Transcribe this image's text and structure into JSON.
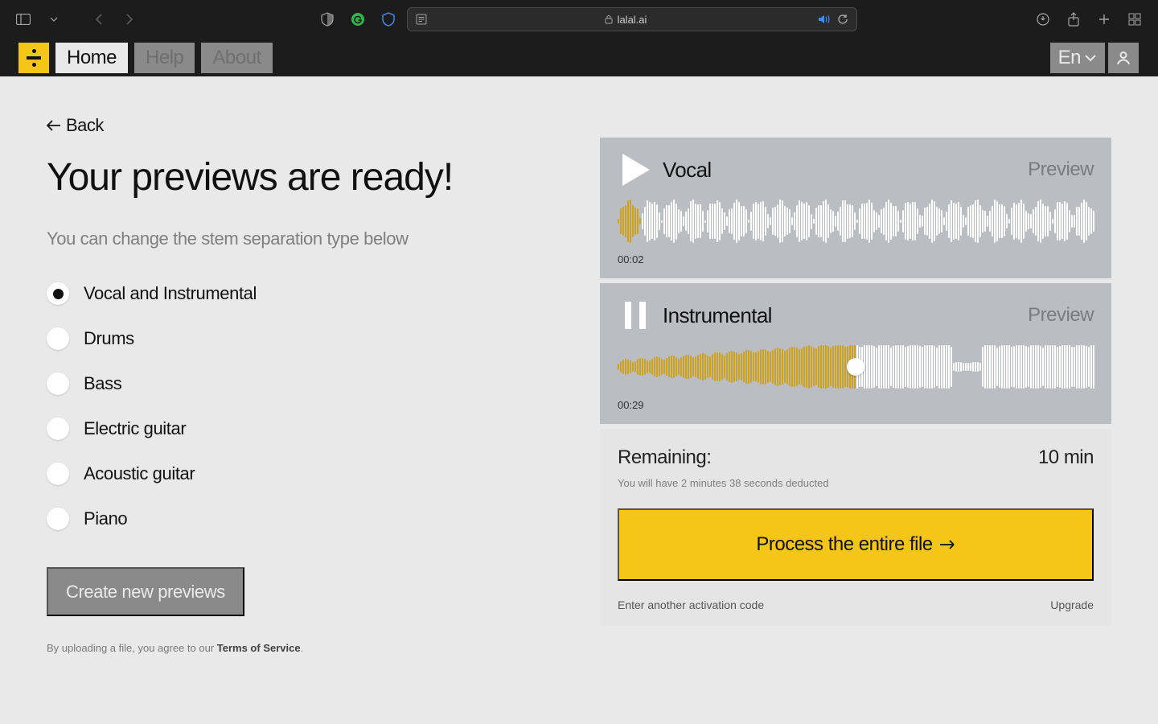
{
  "browser": {
    "url_domain": "lalal.ai"
  },
  "nav": {
    "home": "Home",
    "help": "Help",
    "about": "About",
    "lang": "En"
  },
  "back_label": "Back",
  "title": "Your previews are ready!",
  "subtitle": "You can change the stem separation type below",
  "stems": {
    "opt0": "Vocal and Instrumental",
    "opt1": "Drums",
    "opt2": "Bass",
    "opt3": "Electric guitar",
    "opt4": "Acoustic guitar",
    "opt5": "Piano"
  },
  "create_button": "Create new previews",
  "tos_prefix": "By uploading a file, you agree to our ",
  "tos_link": "Terms of Service",
  "tos_suffix": ".",
  "preview_label": "Preview",
  "tracks": {
    "vocal": {
      "name": "Vocal",
      "time": "00:02",
      "progress": 0.05
    },
    "instrumental": {
      "name": "Instrumental",
      "time": "00:29",
      "progress": 0.5
    }
  },
  "remaining_label": "Remaining:",
  "remaining_value": "10 min",
  "deduct_note": "You will have 2 minutes 38 seconds deducted",
  "process_button": "Process the entire file",
  "enter_code": "Enter another activation code",
  "upgrade": "Upgrade"
}
